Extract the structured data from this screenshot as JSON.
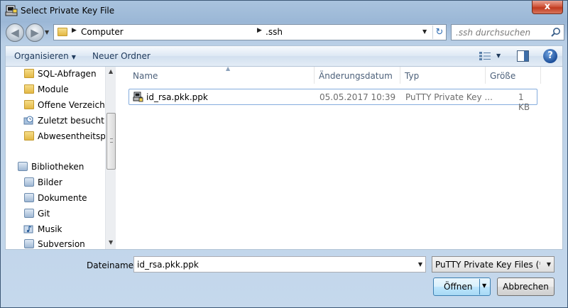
{
  "window": {
    "title": "Select Private Key File",
    "close_label": "x"
  },
  "address_bar": {
    "crumbs": [
      "Computer",
      ".ssh"
    ],
    "search_placeholder": ".ssh durchsuchen"
  },
  "toolbar": {
    "organize_label": "Organisieren",
    "new_folder_label": "Neuer Ordner"
  },
  "nav_pane": {
    "items": [
      {
        "label": "SQL-Abfragen",
        "icon": "folder-icon"
      },
      {
        "label": "Module",
        "icon": "folder-icon"
      },
      {
        "label": "Offene Verzeichni",
        "icon": "folder-icon"
      },
      {
        "label": "Zuletzt besucht",
        "icon": "recent-places-icon"
      },
      {
        "label": "Abwesentheitspla",
        "icon": "folder-icon"
      },
      {
        "label": "Bibliotheken",
        "icon": "libraries-icon"
      },
      {
        "label": "Bilder",
        "icon": "pictures-library-icon"
      },
      {
        "label": "Dokumente",
        "icon": "documents-library-icon"
      },
      {
        "label": "Git",
        "icon": "library-icon"
      },
      {
        "label": "Musik",
        "icon": "music-library-icon"
      },
      {
        "label": "Subversion",
        "icon": "library-icon"
      }
    ]
  },
  "file_list": {
    "columns": [
      "Name",
      "Änderungsdatum",
      "Typ",
      "Größe"
    ],
    "rows": [
      {
        "name": "id_rsa.pkk.ppk",
        "date": "05.05.2017 10:39",
        "type": "PuTTY Private Key ...",
        "size": "1 KB",
        "icon": "putty-key-icon"
      }
    ]
  },
  "footer": {
    "filename_label": "Dateiname:",
    "filename_value": "id_rsa.pkk.ppk",
    "filter_value": "PuTTY Private Key Files (*.ppk)",
    "open_label": "Öffnen",
    "cancel_label": "Abbrechen"
  },
  "colors": {
    "title_bar": "#a9c3de",
    "selection_border": "#84acdd",
    "link_text": "#1e395b"
  }
}
